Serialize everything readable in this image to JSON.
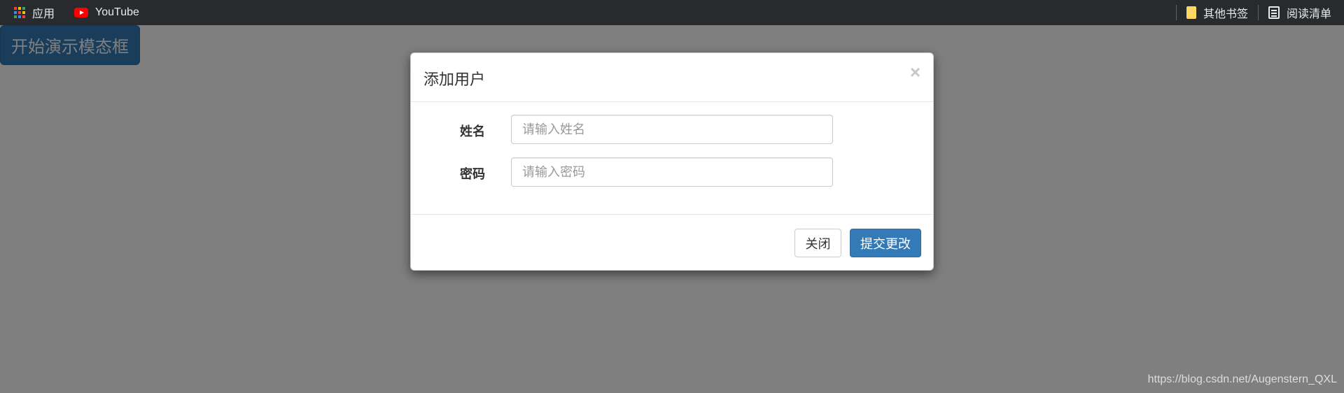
{
  "bookmarks": {
    "apps_label": "应用",
    "youtube_label": "YouTube",
    "other_bookmarks_label": "其他书签",
    "reading_list_label": "阅读清单"
  },
  "page": {
    "start_button_label": "开始演示模态框"
  },
  "modal": {
    "title": "添加用户",
    "close_symbol": "×",
    "fields": [
      {
        "label": "姓名",
        "placeholder": "请输入姓名",
        "value": ""
      },
      {
        "label": "密码",
        "placeholder": "请输入密码",
        "value": ""
      }
    ],
    "close_button_label": "关闭",
    "submit_button_label": "提交更改"
  },
  "watermark": "https://blog.csdn.net/Augenstern_QXL",
  "colors": {
    "primary": "#337ab7",
    "bookmarks_bar": "#292a2d",
    "youtube_red": "#ff0000",
    "folder_yellow": "#fdd663"
  },
  "icons": [
    "apps-grid-icon",
    "youtube-icon",
    "folder-icon",
    "reading-list-icon",
    "close-icon"
  ]
}
